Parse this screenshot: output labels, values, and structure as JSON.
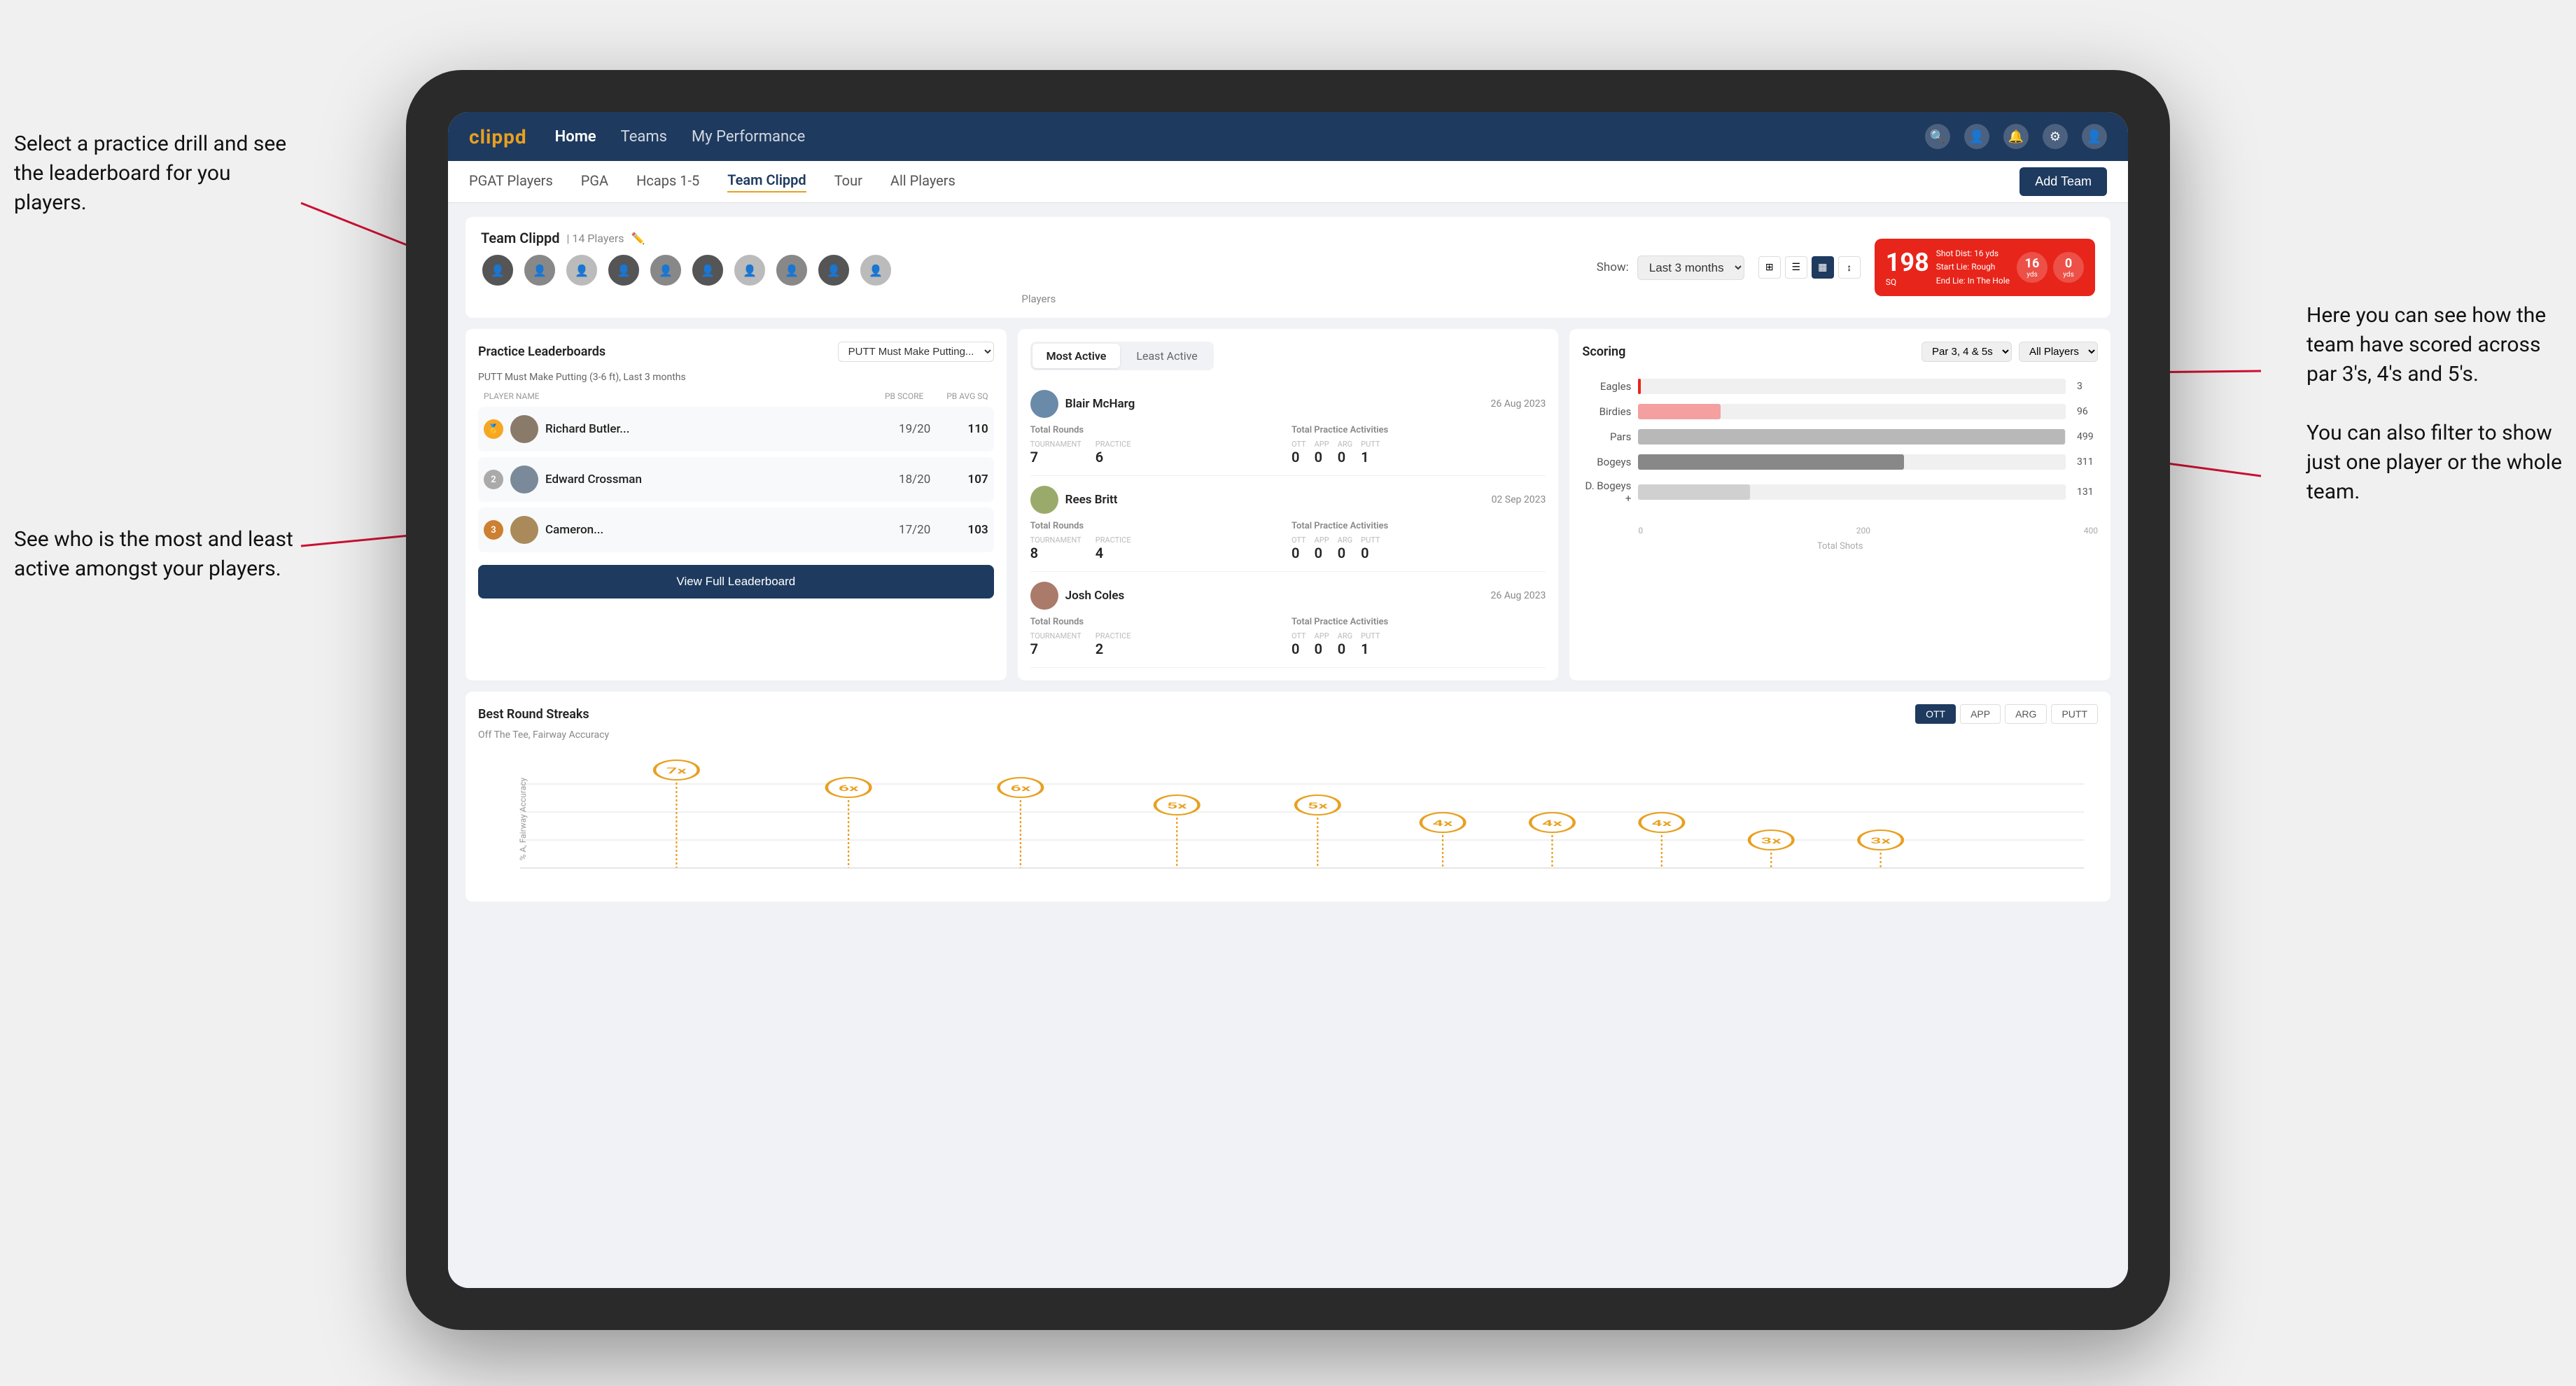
{
  "app": {
    "logo": "clippd",
    "nav_items": [
      "Home",
      "Teams",
      "My Performance"
    ],
    "subnav_items": [
      "PGAT Players",
      "PGA",
      "Hcaps 1-5",
      "Team Clippd",
      "Tour",
      "All Players"
    ],
    "active_subnav": "Team Clippd"
  },
  "team": {
    "name": "Team Clippd",
    "player_count": "14 Players",
    "show_label": "Show:",
    "show_period": "Last 3 months",
    "add_team_label": "Add Team",
    "players_label": "Players"
  },
  "shot_card": {
    "number": "198",
    "unit": "SQ",
    "dist_label": "Shot Dist: 16 yds",
    "start_lie": "Start Lie: Rough",
    "end_lie": "End Lie: In The Hole",
    "yds_left": "16",
    "yds_right": "0"
  },
  "practice_leaderboards": {
    "title": "Practice Leaderboards",
    "drill_select": "PUTT Must Make Putting...",
    "subtitle": "PUTT Must Make Putting (3-6 ft), Last 3 months",
    "col_player": "PLAYER NAME",
    "col_score": "PB SCORE",
    "col_avg": "PB AVG SQ",
    "view_full_label": "View Full Leaderboard",
    "players": [
      {
        "rank": 1,
        "rank_type": "gold",
        "name": "Richard Butler...",
        "score": "19/20",
        "avg": "110"
      },
      {
        "rank": 2,
        "rank_type": "silver",
        "name": "Edward Crossman",
        "score": "18/20",
        "avg": "107"
      },
      {
        "rank": 3,
        "rank_type": "bronze",
        "name": "Cameron...",
        "score": "17/20",
        "avg": "103"
      }
    ]
  },
  "activity": {
    "tab_most": "Most Active",
    "tab_least": "Least Active",
    "active_tab": "most",
    "players": [
      {
        "name": "Blair McHarg",
        "date": "26 Aug 2023",
        "total_rounds_label": "Total Rounds",
        "tournament": "7",
        "practice": "6",
        "tournament_label": "Tournament",
        "practice_label": "Practice",
        "total_practice_label": "Total Practice Activities",
        "ott": "0",
        "app": "0",
        "arg": "0",
        "putt": "1"
      },
      {
        "name": "Rees Britt",
        "date": "02 Sep 2023",
        "total_rounds_label": "Total Rounds",
        "tournament": "8",
        "practice": "4",
        "tournament_label": "Tournament",
        "practice_label": "Practice",
        "total_practice_label": "Total Practice Activities",
        "ott": "0",
        "app": "0",
        "arg": "0",
        "putt": "0"
      },
      {
        "name": "Josh Coles",
        "date": "26 Aug 2023",
        "total_rounds_label": "Total Rounds",
        "tournament": "7",
        "practice": "2",
        "tournament_label": "Tournament",
        "practice_label": "Practice",
        "total_practice_label": "Total Practice Activities",
        "ott": "0",
        "app": "0",
        "arg": "0",
        "putt": "1"
      }
    ]
  },
  "scoring": {
    "title": "Scoring",
    "filter1": "Par 3, 4 & 5s",
    "filter2": "All Players",
    "bars": [
      {
        "label": "Eagles",
        "value": 3,
        "max": 500,
        "type": "red"
      },
      {
        "label": "Birdies",
        "value": 96,
        "max": 500,
        "type": "pink"
      },
      {
        "label": "Pars",
        "value": 499,
        "max": 500,
        "type": "gray"
      },
      {
        "label": "Bogeys",
        "value": 311,
        "max": 500,
        "type": "dark"
      },
      {
        "label": "D. Bogeys +",
        "value": 131,
        "max": 500,
        "type": "light"
      }
    ],
    "axis_labels": [
      "0",
      "200",
      "400"
    ],
    "axis_title": "Total Shots"
  },
  "streaks": {
    "title": "Best Round Streaks",
    "subtitle": "Off The Tee, Fairway Accuracy",
    "filters": [
      "OTT",
      "APP",
      "ARG",
      "PUTT"
    ],
    "active_filter": "OTT",
    "points": [
      {
        "label": "7x",
        "x_pct": 14,
        "y_pct": 85
      },
      {
        "label": "6x",
        "x_pct": 26,
        "y_pct": 72
      },
      {
        "label": "6x",
        "x_pct": 38,
        "y_pct": 72
      },
      {
        "label": "5x",
        "x_pct": 48,
        "y_pct": 60
      },
      {
        "label": "5x",
        "x_pct": 57,
        "y_pct": 60
      },
      {
        "label": "4x",
        "x_pct": 65,
        "y_pct": 45
      },
      {
        "label": "4x",
        "x_pct": 72,
        "y_pct": 45
      },
      {
        "label": "4x",
        "x_pct": 78,
        "y_pct": 45
      },
      {
        "label": "3x",
        "x_pct": 85,
        "y_pct": 30
      },
      {
        "label": "3x",
        "x_pct": 91,
        "y_pct": 30
      }
    ]
  },
  "annotations": {
    "ann1_title": "Select a practice drill and see",
    "ann1_body": "the leaderboard for you players.",
    "ann2_title": "See who is the most and least",
    "ann2_body": "active amongst your players.",
    "ann3_title": "Here you can see how the",
    "ann3_body1": "team have scored across",
    "ann3_body2": "par 3's, 4's and 5's.",
    "ann4_title": "You can also filter to show",
    "ann4_body1": "just one player or the whole",
    "ann4_body2": "team."
  }
}
